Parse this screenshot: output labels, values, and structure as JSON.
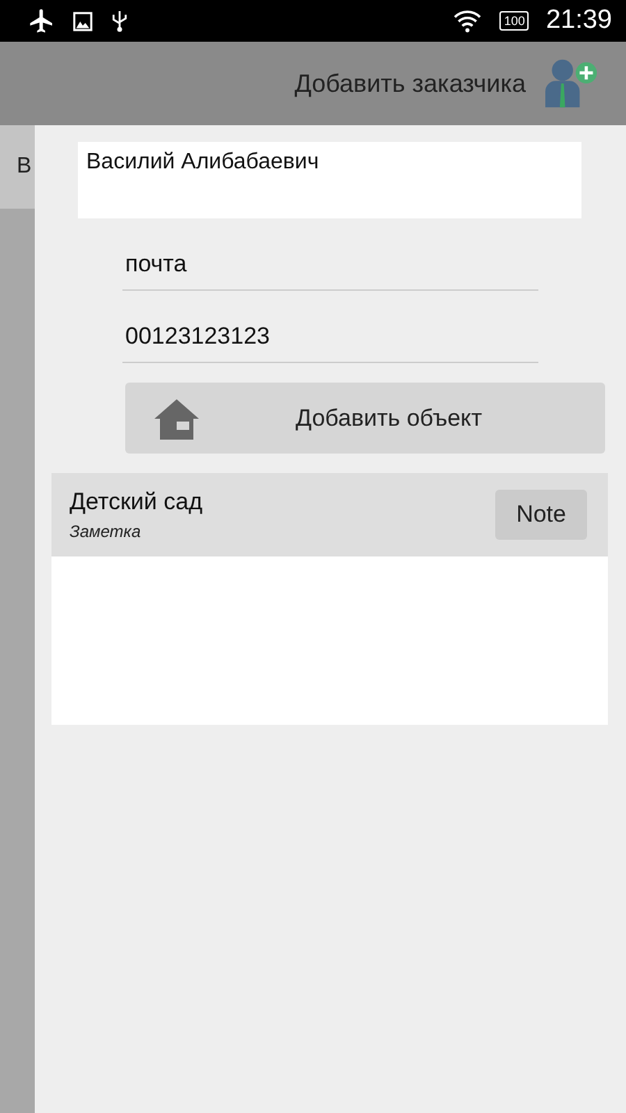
{
  "status_bar": {
    "time": "21:39",
    "battery": "100"
  },
  "app_bar": {
    "action_label": "Добавить заказчика"
  },
  "background_tab": {
    "label": "В"
  },
  "form": {
    "name": {
      "value": "Василий Алибабаевич"
    },
    "email": {
      "value": "почта"
    },
    "phone": {
      "value": "00123123123"
    },
    "add_object_button": {
      "label": "Добавить объект"
    }
  },
  "objects": [
    {
      "title": "Детский сад",
      "note": "Заметка",
      "button": "Note"
    }
  ]
}
